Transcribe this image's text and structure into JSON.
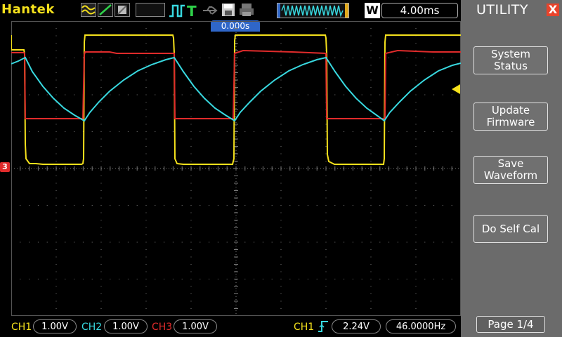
{
  "brand": "Hantek",
  "timebase": {
    "mode": "W",
    "value": "4.00ms"
  },
  "trigger_position": "0.000s",
  "ground_marker": "3",
  "utility": {
    "title": "UTILITY",
    "close": "X",
    "buttons": [
      "System\nStatus",
      "Update\nFirmware",
      "Save\nWaveform",
      "Do Self Cal"
    ],
    "page": "Page 1/4"
  },
  "channels": [
    {
      "name": "CH1",
      "scale": "1.00V",
      "color": "#f5e11c"
    },
    {
      "name": "CH2",
      "scale": "1.00V",
      "color": "#38d8df"
    },
    {
      "name": "CH3",
      "scale": "1.00V",
      "color": "#e02b2b"
    }
  ],
  "trigger": {
    "source": "CH1",
    "level": "2.24V",
    "freq": "46.0000Hz"
  },
  "colors": {
    "grid": "#7a7a7a",
    "ch1": "#f5e11c",
    "ch2": "#38d8df",
    "ch3": "#e02b2b"
  }
}
